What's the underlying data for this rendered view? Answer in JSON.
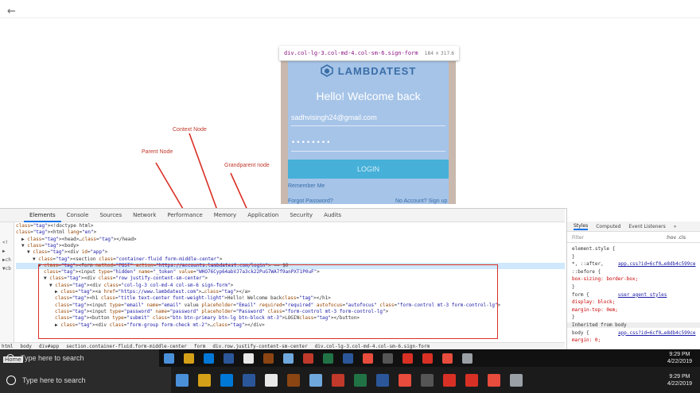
{
  "browser": {
    "back_icon": "arrow-left-icon"
  },
  "tooltip": {
    "selector": "div.col-lg-3.col-md-4.col-sm-6.sign-form",
    "size": "184 × 317.6"
  },
  "form": {
    "logo_text": "LAMBDATEST",
    "heading": "Hello! Welcome back",
    "email_value": "sadhvisingh24@gmail.com",
    "password_value": "••••••••",
    "login_label": "LOGIN",
    "remember_label": "Remember Me",
    "forgot_label": "Forgot Password?",
    "no_account_label": "No Account? Sign up"
  },
  "annotations": {
    "context": "Context Node",
    "parent": "Parent Node",
    "grandparent": "Grandparent node"
  },
  "devtools": {
    "tabs": [
      "Elements",
      "Console",
      "Sources",
      "Network",
      "Performance",
      "Memory",
      "Application",
      "Security",
      "Audits"
    ],
    "active_tab": "Elements",
    "dom_lines": [
      {
        "indent": 0,
        "html": "<!doctype html>"
      },
      {
        "indent": 0,
        "html": "<html lang=\"en\">"
      },
      {
        "indent": 1,
        "html": "▶ <head>…</head>"
      },
      {
        "indent": 1,
        "html": "▼ <body>"
      },
      {
        "indent": 2,
        "html": "▼ <div id=\"app\">"
      },
      {
        "indent": 3,
        "html": "▼ <section class=\"container-fluid form-middle-center\">"
      },
      {
        "indent": 4,
        "html": "▼ <form method=\"POST\" action=\"https://accounts.lambdatest.com/login\"> == $0",
        "selected": true
      },
      {
        "indent": 5,
        "html": "<input type=\"hidden\" name=\"_token\" value=\"WHO76Cyp64abVJ7a3ck22PuG7WA7f9anPXT1P0uF\">"
      },
      {
        "indent": 5,
        "html": "▼ <div class=\"row justify-content-sm-center\">"
      },
      {
        "indent": 6,
        "html": "▼ <div class=\"col-lg-3 col-md-4 col-sm-6 sign-form\">"
      },
      {
        "indent": 7,
        "html": "▶ <a href=\"https://www.lambdatest.com\">…</a>"
      },
      {
        "indent": 7,
        "html": "<h1 class=\"title text-center font-weight-light\">Hello! Welcome back</h1>"
      },
      {
        "indent": 7,
        "html": "<input type=\"email\" name=\"email\" value placeholder=\"Email\" required=\"required\" autofocus=\"autofocus\" class=\"form-control mt-3 form-control-lg\">"
      },
      {
        "indent": 7,
        "html": "<input type=\"password\" name=\"password\" placeholder=\"Password\" class=\"form-control mt-3 form-control-lg\">"
      },
      {
        "indent": 7,
        "html": "<button type=\"submit\" class=\"btn btn-primary btn-lg btn-block mt-3\">LOGIN</button>"
      },
      {
        "indent": 7,
        "html": "▶ <div class=\"form-group form-check mt-2\">…</div>"
      }
    ],
    "breadcrumb": [
      "html",
      "body",
      "div#app",
      "section.container-fluid.form-middle-center",
      "form",
      "div.row.justify-content-sm-center",
      "div.col-lg-3.col-md-4.col-sm-6.sign-form"
    ],
    "left_sidebar": [
      "<!",
      "▶",
      "▶ch",
      "▼cb"
    ]
  },
  "styles": {
    "tabs": [
      "Styles",
      "Computed",
      "Event Listeners",
      "»"
    ],
    "active_tab": "Styles",
    "filter_placeholder": "Filter",
    "hov_label": ":hov  .cls",
    "lines": [
      {
        "text": "element.style {",
        "kind": "sel"
      },
      {
        "text": "}",
        "kind": "sel"
      },
      {
        "text": "*, ::after,",
        "kind": "sel",
        "link": "app.css?id=6cf0…e8db4c599ce"
      },
      {
        "text": "::before {",
        "kind": "sel"
      },
      {
        "text": "  box-sizing: border-box;",
        "kind": "prop"
      },
      {
        "text": "}",
        "kind": "sel"
      },
      {
        "text": "form {",
        "kind": "sel",
        "link": "user agent styles"
      },
      {
        "text": "  display: block;",
        "kind": "prop"
      },
      {
        "text": "  margin-top: 0em;",
        "kind": "prop"
      },
      {
        "text": "}",
        "kind": "sel"
      },
      {
        "text": "Inherited from body",
        "kind": "inherit"
      },
      {
        "text": "body {",
        "kind": "sel",
        "link": "app.css?id=6cf0…e8db4c599ce"
      },
      {
        "text": "  margin: 0;",
        "kind": "prop"
      }
    ]
  },
  "taskbar": {
    "search_placeholder": "Type here to search",
    "time": "9:29 PM",
    "date": "4/22/2019",
    "home_label": "Home",
    "app_colors": [
      "#4a90d9",
      "#d4a017",
      "#0078d7",
      "#2b579a",
      "#e8e8e8",
      "#8b4513",
      "#6fa8dc",
      "#c0392b",
      "#217346",
      "#2b579a",
      "#e74c3c",
      "#555555",
      "#d93025",
      "#d93025",
      "#e74c3c",
      "#9aa0a6"
    ]
  },
  "colors": {
    "highlight_box": "#d93025",
    "form_bg": "#a6c4e8",
    "login_btn": "#46b0d8"
  }
}
